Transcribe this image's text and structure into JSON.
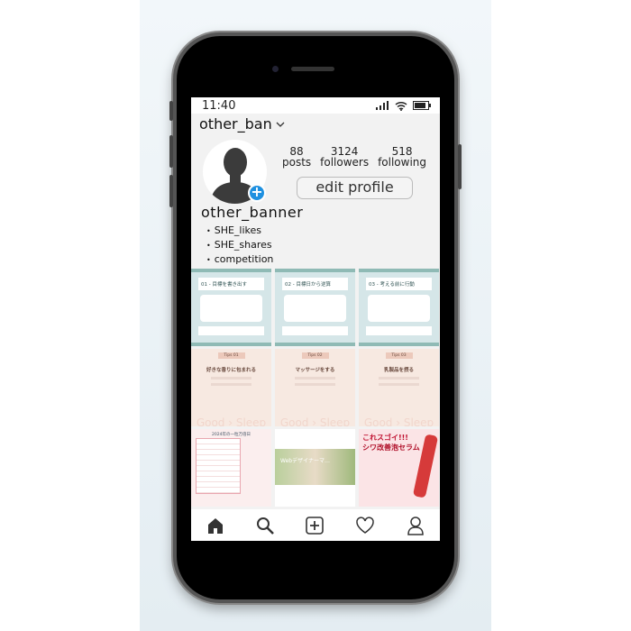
{
  "status_bar": {
    "time": "11:40"
  },
  "profile": {
    "username_header": "other_ban",
    "display_name": "other_banner",
    "stats": [
      {
        "value": "88",
        "label": "posts"
      },
      {
        "value": "3124",
        "label": "followers"
      },
      {
        "value": "518",
        "label": "following"
      }
    ],
    "edit_button": "edit profile",
    "bio": [
      "SHE_likes",
      "SHE_shares",
      "competition"
    ]
  },
  "posts": {
    "row1": [
      "01 - 目標を書き出す",
      "02 - 目標日から逆算",
      "03 - 考える前に行動"
    ],
    "row2": [
      {
        "tag": "Tips 01",
        "title": "好きな香りに包まれる"
      },
      {
        "tag": "Tips 02",
        "title": "マッサージをする"
      },
      {
        "tag": "Tips 03",
        "title": "乳製品を摂る"
      }
    ],
    "row2_footer": "Good › Sleep",
    "row3": {
      "calendar_title": "2024年の一粒万倍日",
      "web_caption": "Webデザイナーマ…",
      "ad_heading": "これスゴイ!!!",
      "ad_product": "シワ改善泡セラム"
    }
  },
  "nav": [
    "home-icon",
    "search-icon",
    "add-post-icon",
    "heart-icon",
    "profile-icon"
  ],
  "colors": {
    "accent": "#1e90e0",
    "phone": "#000000"
  }
}
